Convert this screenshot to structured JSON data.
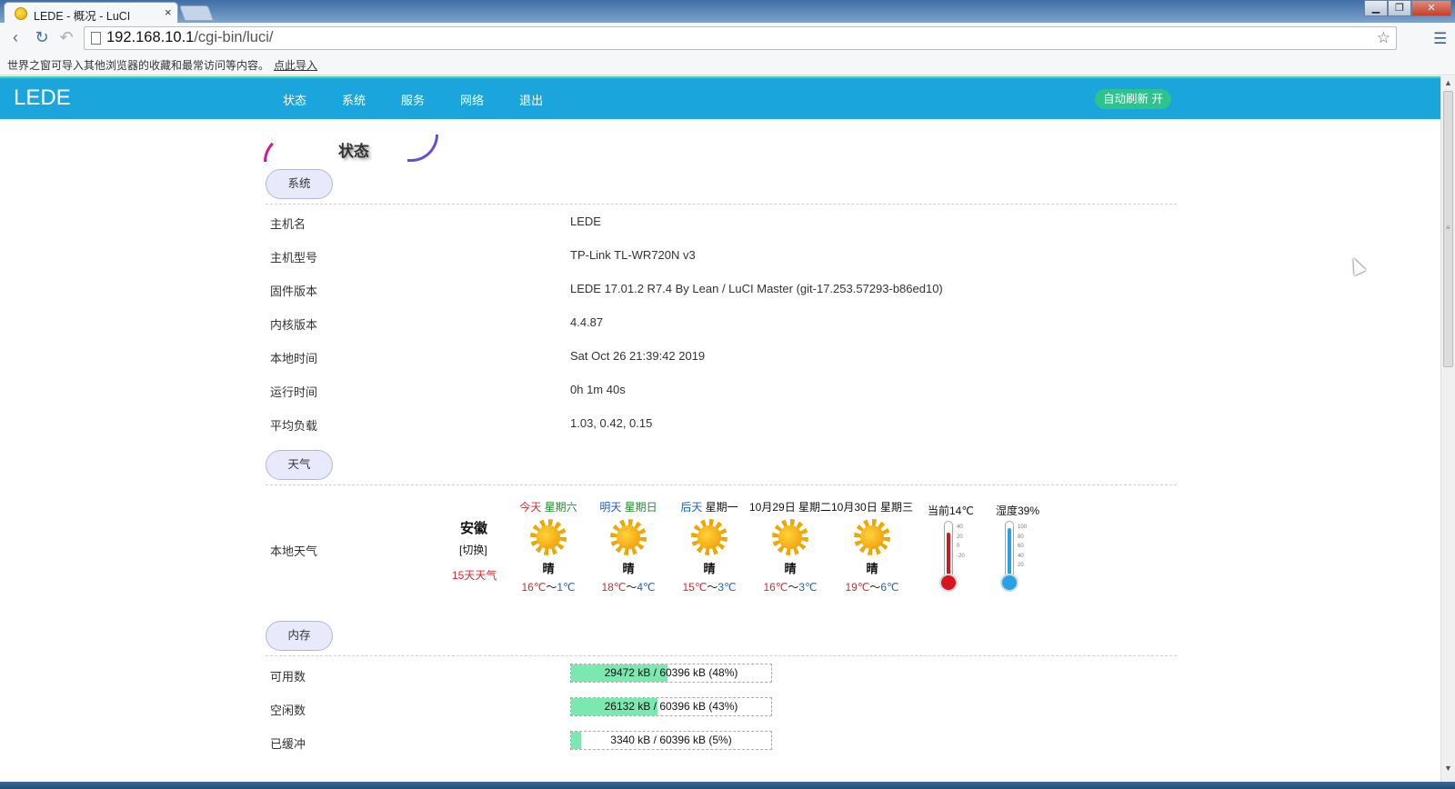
{
  "browser": {
    "tab_title": "LEDE - 概况 - LuCI",
    "tab_close": "×",
    "url_host": "192.168.10.1",
    "url_path": "/cgi-bin/luci/",
    "bookmark_notice": "世界之窗可导入其他浏览器的收藏和最常访问等内容。",
    "bookmark_link": "点此导入",
    "win_minimize": "▁",
    "win_restore": "❐",
    "win_close": "✕"
  },
  "header": {
    "brand": "LEDE",
    "nav": [
      "状态",
      "系统",
      "服务",
      "网络",
      "退出"
    ],
    "autorefresh": "自动刷新 开"
  },
  "page": {
    "title": "状态"
  },
  "system": {
    "section": "系统",
    "rows": [
      {
        "label": "主机名",
        "value": "LEDE"
      },
      {
        "label": "主机型号",
        "value": "TP-Link TL-WR720N v3"
      },
      {
        "label": "固件版本",
        "value": "LEDE 17.01.2 R7.4 By Lean / LuCI Master (git-17.253.57293-b86ed10)"
      },
      {
        "label": "内核版本",
        "value": "4.4.87"
      },
      {
        "label": "本地时间",
        "value": "Sat Oct 26 21:39:42 2019"
      },
      {
        "label": "运行时间",
        "value": "0h 1m 40s"
      },
      {
        "label": "平均负载",
        "value": "1.03, 0.42, 0.15"
      }
    ]
  },
  "weather": {
    "section": "天气",
    "label": "本地天气",
    "province": "安徽",
    "switch": "[切换]",
    "fifteen_day": "15天天气",
    "days": [
      {
        "rel": "今天",
        "week": "星期六",
        "date": "",
        "cond": "晴",
        "hi": "16℃",
        "sep": "～",
        "lo": "1℃"
      },
      {
        "rel": "明天",
        "week": "星期日",
        "date": "",
        "cond": "晴",
        "hi": "18℃",
        "sep": "～",
        "lo": "4℃"
      },
      {
        "rel": "后天",
        "week": "星期一",
        "date": "",
        "cond": "晴",
        "hi": "15℃",
        "sep": "～",
        "lo": "3℃"
      },
      {
        "rel": "",
        "week": "星期二",
        "date": "10月29日",
        "cond": "晴",
        "hi": "16℃",
        "sep": "～",
        "lo": "3℃"
      },
      {
        "rel": "",
        "week": "星期三",
        "date": "10月30日",
        "cond": "晴",
        "hi": "19℃",
        "sep": "～",
        "lo": "6℃"
      }
    ],
    "current_temp": "当前14℃",
    "humidity": "湿度39%",
    "temp_scale": [
      "40",
      "20",
      "0",
      "-20"
    ],
    "humidity_scale": [
      "100",
      "80",
      "60",
      "40",
      "20"
    ],
    "temp_color": "#d9141b",
    "humidity_color": "#2aa0e6",
    "humidity_level": 0.39
  },
  "memory": {
    "section": "内存",
    "rows": [
      {
        "label": "可用数",
        "text": "29472 kB / 60396 kB (48%)",
        "percent": 48
      },
      {
        "label": "空闲数",
        "text": "26132 kB / 60396 kB (43%)",
        "percent": 43
      },
      {
        "label": "已缓冲",
        "text": "3340 kB / 60396 kB (5%)",
        "percent": 5
      }
    ]
  },
  "colors": {
    "header_bg": "#1aa6dc",
    "autorefresh_bg": "#2fc28c",
    "bar_fill": "#7be8b0",
    "section_bg": "#e8e9fb"
  }
}
